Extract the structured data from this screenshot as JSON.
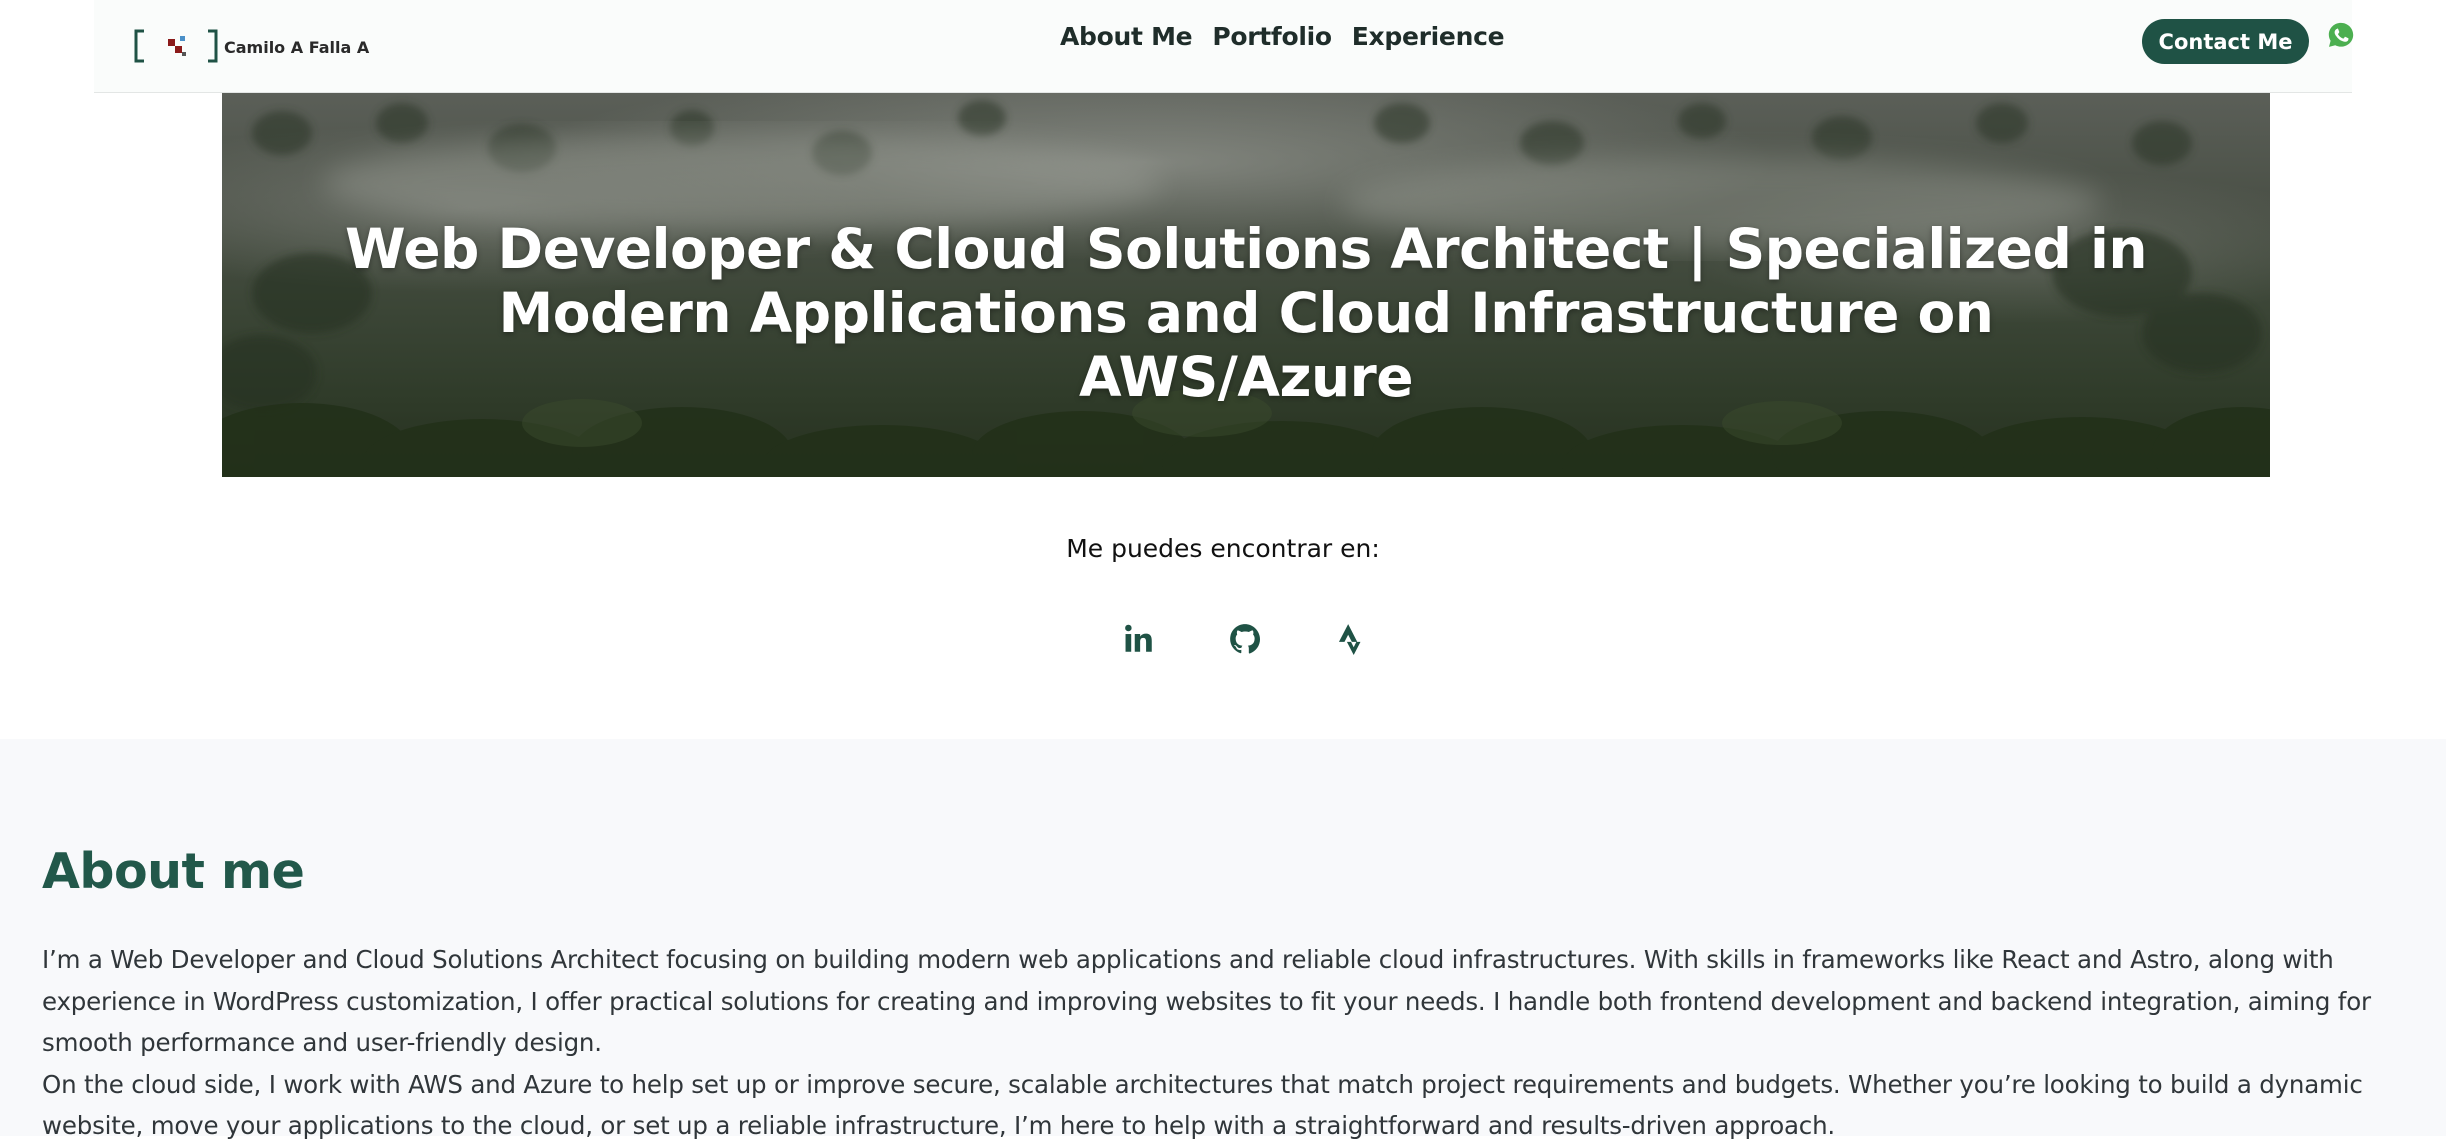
{
  "header": {
    "brand_name": "Camilo A Falla A",
    "nav": [
      {
        "label": "About Me"
      },
      {
        "label": "Portfolio"
      },
      {
        "label": "Experience"
      }
    ],
    "contact_label": "Contact Me",
    "whatsapp_icon": "whatsapp-icon"
  },
  "hero": {
    "title": "Web Developer & Cloud Solutions Architect | Specialized in Modern Applications and Cloud Infrastructure on AWS/Azure"
  },
  "find_me": {
    "label": "Me puedes encontrar en:",
    "links": [
      {
        "icon": "linkedin-icon"
      },
      {
        "icon": "github-icon"
      },
      {
        "icon": "strava-icon"
      }
    ]
  },
  "about": {
    "title": "About me",
    "paragraph_1": "I’m a Web Developer and Cloud Solutions Architect focusing on building modern web applications and reliable cloud infrastructures. With skills in frameworks like React and Astro, along with experience in WordPress customization, I offer practical solutions for creating and improving websites to fit your needs. I handle both frontend development and backend integration, aiming for smooth performance and user-friendly design.",
    "paragraph_2": "On the cloud side, I work with AWS and Azure to help set up or improve secure, scalable architectures that match project requirements and budgets. Whether you’re looking to build a dynamic website, move your applications to the cloud, or set up a reliable infrastructure, I’m here to help with a straightforward and results-driven approach."
  },
  "colors": {
    "brand_green": "#1f5245",
    "heading_green": "#22584a",
    "whatsapp_green": "#4caf50",
    "logo_red": "#8b1a1a",
    "logo_blue": "#4a90c8"
  }
}
